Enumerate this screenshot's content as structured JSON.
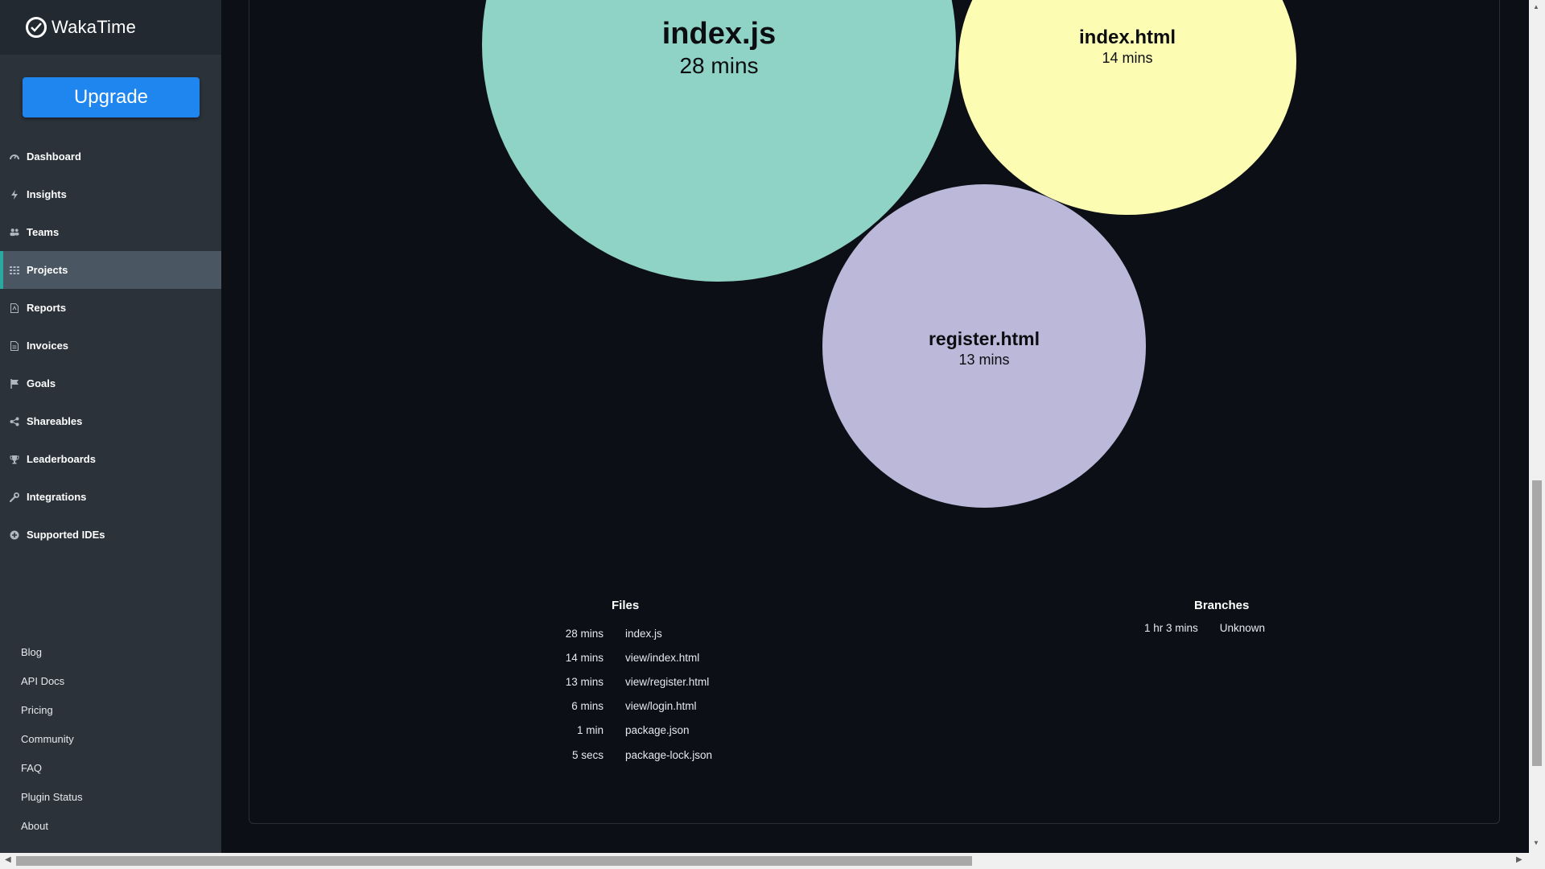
{
  "app": {
    "name": "WakaTime"
  },
  "sidebar": {
    "upgrade_label": "Upgrade",
    "items": [
      {
        "label": "Dashboard",
        "icon": "dashboard-icon"
      },
      {
        "label": "Insights",
        "icon": "bolt-icon"
      },
      {
        "label": "Teams",
        "icon": "users-icon"
      },
      {
        "label": "Projects",
        "icon": "grid-icon",
        "active": true
      },
      {
        "label": "Reports",
        "icon": "pdf-icon"
      },
      {
        "label": "Invoices",
        "icon": "invoice-icon"
      },
      {
        "label": "Goals",
        "icon": "flag-icon"
      },
      {
        "label": "Shareables",
        "icon": "share-icon"
      },
      {
        "label": "Leaderboards",
        "icon": "trophy-icon"
      },
      {
        "label": "Integrations",
        "icon": "wrench-icon"
      },
      {
        "label": "Supported IDEs",
        "icon": "plus-circle-icon"
      }
    ],
    "footer_links": [
      "Blog",
      "API Docs",
      "Pricing",
      "Community",
      "FAQ",
      "Plugin Status",
      "About"
    ]
  },
  "bubbles": [
    {
      "name": "index.js",
      "time": "28 mins",
      "color": "#8fd3c7"
    },
    {
      "name": "index.html",
      "time": "14 mins",
      "color": "#fdfcb3"
    },
    {
      "name": "register.html",
      "time": "13 mins",
      "color": "#bcb8d9"
    }
  ],
  "files": {
    "title": "Files",
    "rows": [
      {
        "time": "28 mins",
        "name": "index.js"
      },
      {
        "time": "14 mins",
        "name": "view/index.html"
      },
      {
        "time": "13 mins",
        "name": "view/register.html"
      },
      {
        "time": "6 mins",
        "name": "view/login.html"
      },
      {
        "time": "1 min",
        "name": "package.json"
      },
      {
        "time": "5 secs",
        "name": "package-lock.json"
      }
    ]
  },
  "branches": {
    "title": "Branches",
    "rows": [
      {
        "time": "1 hr 3 mins",
        "name": "Unknown"
      }
    ]
  },
  "colors": {
    "accent": "#1f86ef",
    "active_indicator": "#2aa9a0"
  }
}
